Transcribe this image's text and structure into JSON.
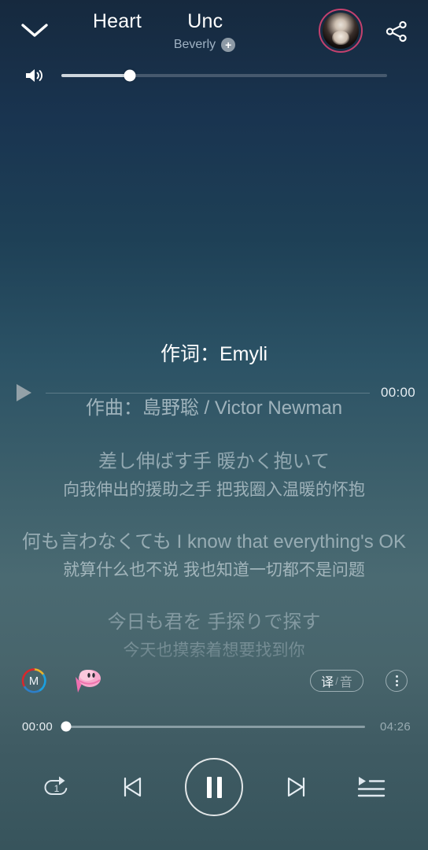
{
  "header": {
    "collapse_icon": "chevron-down-icon",
    "title_scroll": "y Heart",
    "title_scroll_2": "Unc",
    "artist": "Beverly",
    "follow_label": "+",
    "share_icon": "share-icon",
    "avatar_icon": "avatar"
  },
  "volume": {
    "icon": "volume-icon",
    "level_percent": 21
  },
  "lyric_seek": {
    "play_icon": "play-icon",
    "time": "00:00"
  },
  "lyrics": [
    {
      "text": "作词：Emyli",
      "style": "main"
    },
    {
      "text": "作曲：島野聡 / Victor Newman",
      "style": "dim"
    },
    {
      "text": "差し伸ばす手 暖かく抱いて",
      "style": "dim2"
    },
    {
      "text": "向我伸出的援助之手  把我圈入温暖的怀抱",
      "style": "trans"
    },
    {
      "text": "何も言わなくても I know that everything's OK",
      "style": "dim2"
    },
    {
      "text": "就算什么也不说  我也知道一切都不是问题",
      "style": "trans"
    },
    {
      "text": "今日も君を 手探りで探す",
      "style": "fade-main"
    },
    {
      "text": "今天也摸索着想要找到你",
      "style": "fade-trans"
    }
  ],
  "action_bar": {
    "logo_letter": "M",
    "logo_name": "m-logo-icon",
    "sticker_name": "kirby-sticker-icon",
    "translate_on": "译",
    "translate_sep": "/",
    "translate_off": "音",
    "more_icon": "more-options-icon"
  },
  "progress": {
    "current_time": "00:00",
    "total_time": "04:26",
    "percent": 0
  },
  "controls": {
    "repeat_mode": "repeat-one",
    "repeat_badge": "1",
    "previous": "previous-track-icon",
    "play_state": "pause-icon",
    "next": "next-track-icon",
    "playlist": "playlist-queue-icon"
  },
  "colors": {
    "accent_ring": "#c4416e",
    "bg_top": "#16293e",
    "bg_bottom": "#37545c",
    "text_primary": "#ffffff"
  }
}
